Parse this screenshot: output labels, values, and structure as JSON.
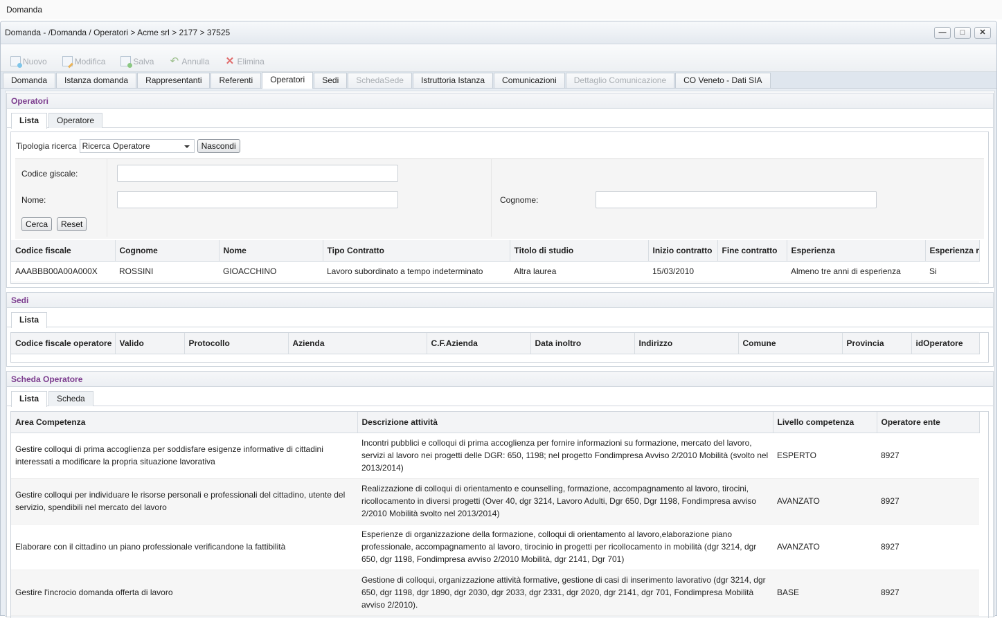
{
  "top_title": "Domanda",
  "window": {
    "title": "Domanda - /Domanda / Operatori > Acme srl > 2177 > 37525",
    "buttons": {
      "minimize": "—",
      "maximize": "□",
      "close": "✕"
    }
  },
  "toolbar": {
    "new": "Nuovo",
    "edit": "Modifica",
    "save": "Salva",
    "cancel": "Annulla",
    "delete": "Elimina"
  },
  "main_tabs": [
    {
      "label": "Domanda"
    },
    {
      "label": "Istanza domanda"
    },
    {
      "label": "Rappresentanti"
    },
    {
      "label": "Referenti"
    },
    {
      "label": "Operatori"
    },
    {
      "label": "Sedi"
    },
    {
      "label": "SchedaSede"
    },
    {
      "label": "Istruttoria Istanza"
    },
    {
      "label": "Comunicazioni"
    },
    {
      "label": "Dettaglio Comunicazione"
    },
    {
      "label": "CO Veneto - Dati SIA"
    }
  ],
  "operatori": {
    "title": "Operatori",
    "tabs": [
      "Lista",
      "Operatore"
    ],
    "search": {
      "type_label": "Tipologia ricerca",
      "type_value": "Ricerca Operatore",
      "hide_button": "Nascondi",
      "fiscal_code_label": "Codice giscale:",
      "fiscal_code_value": "",
      "name_label": "Nome:",
      "name_value": "",
      "surname_label": "Cognome:",
      "surname_value": "",
      "search_button": "Cerca",
      "reset_button": "Reset"
    },
    "columns": [
      "Codice fiscale",
      "Cognome",
      "Nome",
      "Tipo Contratto",
      "Titolo di studio",
      "Inizio contratto",
      "Fine contratto",
      "Esperienza",
      "Esperienza r"
    ],
    "rows": [
      [
        "AAABBB00A00A000X",
        "ROSSINI",
        "GIOACCHINO",
        "Lavoro subordinato a tempo indeterminato",
        "Altra laurea",
        "15/03/2010",
        "",
        "Almeno tre anni di esperienza",
        "Si"
      ]
    ]
  },
  "sedi": {
    "title": "Sedi",
    "tabs": [
      "Lista"
    ],
    "columns": [
      "Codice fiscale operatore",
      "Valido",
      "Protocollo",
      "Azienda",
      "C.F.Azienda",
      "Data inoltro",
      "Indirizzo",
      "Comune",
      "Provincia",
      "idOperatore"
    ]
  },
  "scheda": {
    "title": "Scheda Operatore",
    "tabs": [
      "Lista",
      "Scheda"
    ],
    "columns": [
      "Area Competenza",
      "Descrizione attività",
      "Livello competenza",
      "Operatore ente"
    ],
    "rows": [
      [
        "Gestire colloqui di prima accoglienza per soddisfare esigenze informative di cittadini interessati a modificare la propria situazione lavorativa",
        "Incontri pubblici e colloqui di prima accoglienza per fornire informazioni su formazione, mercato del lavoro, servizi al lavoro nei progetti delle DGR: 650, 1198; nel progetto Fondimpresa Avviso 2/2010 Mobilità (svolto nel 2013/2014)",
        "ESPERTO",
        "8927"
      ],
      [
        "Gestire colloqui per individuare le risorse personali e professionali del cittadino, utente del servizio, spendibili nel mercato del lavoro",
        "Realizzazione di colloqui di orientamento e counselling, formazione, accompagnamento al lavoro, tirocini, ricollocamento in diversi progetti (Over 40, dgr 3214, Lavoro Adulti, Dgr 650, Dgr 1198, Fondimpresa avviso 2/2010 Mobilità svolto nel 2013/2014)",
        "AVANZATO",
        "8927"
      ],
      [
        "Elaborare con il cittadino un piano professionale verificandone la fattibilità",
        "Esperienze di organizzazione della formazione, colloqui di orientamento al lavoro,elaborazione piano professionale, accompagnamento al lavoro, tirocinio in progetti per ricollocamento in mobilità (dgr 3214, dgr 650, dgr 1198, Fondimpresa avviso 2/2010 Mobilità, dgr 2141, Dgr 701)",
        "AVANZATO",
        "8927"
      ],
      [
        "Gestire l'incrocio domanda offerta di lavoro",
        "Gestione di colloqui, organizzazione attività formative, gestione di casi di inserimento lavorativo (dgr 3214, dgr 650, dgr 1198, dgr 1890, dgr 2030, dgr 2033, dgr 2331, dgr 2020, dgr 2141, dgr 701, Fondimpresa Mobilità avviso 2/2010).",
        "BASE",
        "8927"
      ]
    ]
  }
}
